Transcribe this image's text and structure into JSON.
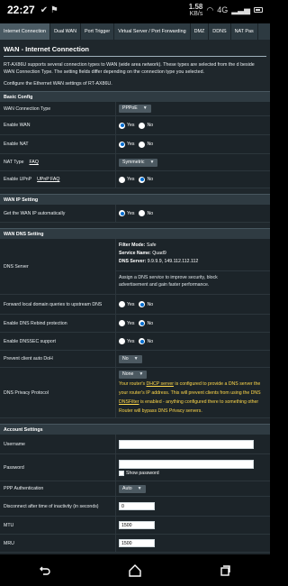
{
  "status_bar": {
    "time": "22:27",
    "net_speed_value": "1.58",
    "net_speed_unit": "KB/s",
    "network": "4G",
    "signal": "⁂"
  },
  "tabs": [
    {
      "label": "Internet Connection",
      "active": true
    },
    {
      "label": "Dual WAN",
      "active": false
    },
    {
      "label": "Port Trigger",
      "active": false
    },
    {
      "label": "Virtual Server / Port Forwarding",
      "active": false
    },
    {
      "label": "DMZ",
      "active": false
    },
    {
      "label": "DDNS",
      "active": false
    },
    {
      "label": "NAT Pas",
      "active": false
    }
  ],
  "page": {
    "title": "WAN - Internet Connection",
    "description": "RT-AX86U supports several connection types to WAN (wide area network). These types are selected from the d beside WAN Connection Type. The setting fields differ depending on the connection type you selected.",
    "configure": "Configure the Ethernet WAN settings of RT-AX86U."
  },
  "basic_config": {
    "header": "Basic Config",
    "wan_connection_type_label": "WAN Connection Type",
    "wan_connection_type_value": "PPPoE",
    "enable_wan_label": "Enable WAN",
    "enable_nat_label": "Enable NAT",
    "nat_type_label": "NAT Type",
    "nat_type_faq": "FAQ",
    "nat_type_value": "Symmetric",
    "enable_upnp_label": "Enable UPnP",
    "enable_upnp_faq": "UPnP FAQ",
    "yes": "Yes",
    "no": "No"
  },
  "wan_ip": {
    "header": "WAN IP Setting",
    "auto_ip_label": "Get the WAN IP automatically"
  },
  "wan_dns": {
    "header": "WAN DNS Setting",
    "dns_server_label": "DNS Server",
    "filter_mode_key": "Filter Mode:",
    "filter_mode_value": "Safe",
    "service_name_key": "Service Name:",
    "service_name_value": "Quad9",
    "dns_server_key": "DNS Server:",
    "dns_server_value": "9.9.9.9, 149.112.112.112",
    "assign_note_1": "Assign a DNS service to improve security, block",
    "assign_note_2": "advertisement and gain faster performance.",
    "forward_label": "Forward local domain queries to upstream DNS",
    "rebind_label": "Enable DNS Rebind protection",
    "dnssec_label": "Enable DNSSEC support",
    "prevent_doh_label": "Prevent client auto DoH",
    "prevent_doh_value": "No",
    "privacy_label": "DNS Privacy Protocol",
    "privacy_value": "None",
    "warn_1a": "Your router's ",
    "warn_1_link": "DHCP server",
    "warn_1b": " is configured to provide a DNS server the",
    "warn_2": "your router's IP address. This will prevent clients from using the DNS",
    "warn_3_link": "DNSFilter",
    "warn_3b": " is enabled - anything configured there to something other",
    "warn_4": "Router will bypass DNS Privacy servers."
  },
  "account": {
    "header": "Account Settings",
    "username_label": "Username",
    "password_label": "Password",
    "show_password": "Show password",
    "ppp_auth_label": "PPP Authentication",
    "ppp_auth_value": "Auto",
    "disconnect_label": "Disconnect after time of inactivity (in seconds)",
    "disconnect_value": "0",
    "mtu_label": "MTU",
    "mtu_value": "1500",
    "mru_label": "MRU",
    "mru_value": "1500"
  }
}
